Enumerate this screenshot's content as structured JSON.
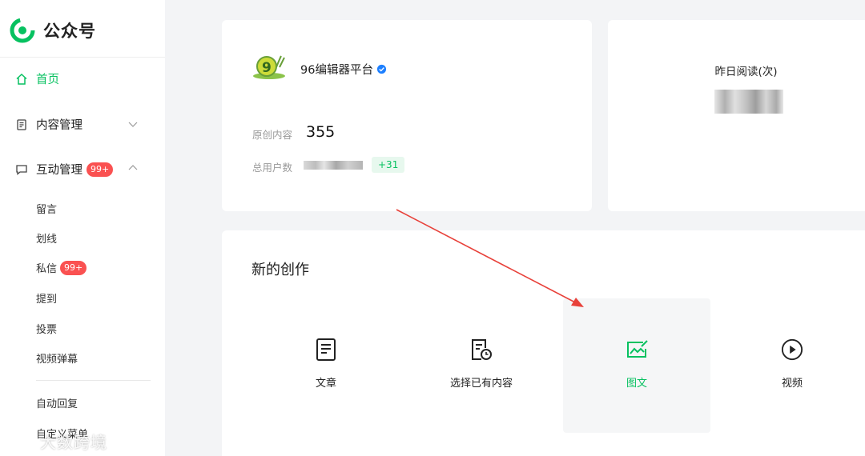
{
  "brand": {
    "name": "公众号",
    "logo_icon": "wechat-mp-logo-icon",
    "accent": "#07c160"
  },
  "sidebar": {
    "home": "首页",
    "content_mgmt": "内容管理",
    "interaction_mgmt": "互动管理",
    "interaction_badge": "99+",
    "sub_items": [
      {
        "label": "留言"
      },
      {
        "label": "划线"
      },
      {
        "label": "私信",
        "badge": "99+"
      },
      {
        "label": "提到"
      },
      {
        "label": "投票"
      },
      {
        "label": "视频弹幕"
      }
    ],
    "auto_reply": "自动回复",
    "custom_menu": "自定义菜单"
  },
  "profile": {
    "account_name": "96编辑器平台",
    "original_label": "原创内容",
    "original_value": "355",
    "users_label": "总用户数",
    "users_delta": "+31"
  },
  "stats": {
    "yesterday_reads_label": "昨日阅读(次)"
  },
  "create": {
    "title": "新的创作",
    "tiles": [
      {
        "label": "文章",
        "icon": "article-icon"
      },
      {
        "label": "选择已有内容",
        "icon": "existing-content-icon"
      },
      {
        "label": "图文",
        "icon": "image-post-icon"
      },
      {
        "label": "视频",
        "icon": "video-play-icon"
      }
    ]
  },
  "watermark": {
    "text": "大数跨境"
  },
  "colors": {
    "green": "#07c160",
    "red_badge": "#fa5151",
    "arrow": "#e8413a"
  }
}
